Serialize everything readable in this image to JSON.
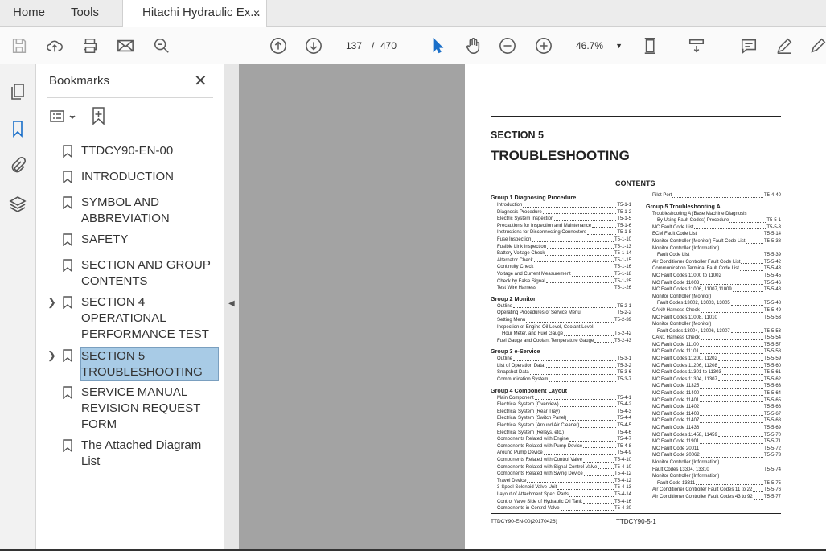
{
  "tabs": {
    "home": "Home",
    "tools": "Tools",
    "doc": "Hitachi Hydraulic Ex...",
    "close": "×"
  },
  "toolbar": {
    "page_current": "137",
    "page_sep": "/",
    "page_total": "470",
    "zoom": "46.7%"
  },
  "bookmarks": {
    "title": "Bookmarks",
    "close": "✕",
    "items": [
      {
        "label": "TTDCY90-EN-00",
        "expandable": false
      },
      {
        "label": "INTRODUCTION",
        "expandable": false
      },
      {
        "label": "SYMBOL AND ABBREVIATION",
        "expandable": false
      },
      {
        "label": "SAFETY",
        "expandable": false
      },
      {
        "label": "SECTION AND GROUP CONTENTS",
        "expandable": false
      },
      {
        "label": "SECTION 4 OPERATIONAL PERFORMANCE TEST",
        "expandable": true
      },
      {
        "label": "SECTION 5 TROUBLESHOOTING",
        "expandable": true,
        "selected": true
      },
      {
        "label": "SERVICE MANUAL REVISION REQUEST FORM",
        "expandable": false
      },
      {
        "label": "The Attached Diagram List",
        "expandable": false
      }
    ]
  },
  "page": {
    "section": "SECTION 5",
    "title": "TROUBLESHOOTING",
    "contents": "CONTENTS",
    "footer_left": "TTDCY90-EN-00(20170426)",
    "footer_right": "TTDCY90-5-1",
    "left_column": [
      {
        "h": "Group 1 Diagnosing Procedure"
      },
      {
        "t": "Introduction",
        "p": "T5-1-1"
      },
      {
        "t": "Diagnosis Procedure",
        "p": "T5-1-2"
      },
      {
        "t": "Electric System Inspection",
        "p": "T5-1-5"
      },
      {
        "t": "Precautions for Inspection and Maintenance",
        "p": "T5-1-6"
      },
      {
        "t": "Instructions for Disconnecting Connectors",
        "p": "T5-1-8"
      },
      {
        "t": "Fuse Inspection",
        "p": "T5-1-10"
      },
      {
        "t": "Fusible Link Inspection",
        "p": "T5-1-13"
      },
      {
        "t": "Battery Voltage Check",
        "p": "T5-1-14"
      },
      {
        "t": "Alternator Check",
        "p": "T5-1-15"
      },
      {
        "t": "Continuity Check",
        "p": "T5-1-16"
      },
      {
        "t": "Voltage and Current Measurement",
        "p": "T5-1-18"
      },
      {
        "t": "Check by False Signal",
        "p": "T5-1-25"
      },
      {
        "t": "Test Wire Harness",
        "p": "T5-1-26"
      },
      {
        "h": "Group 2 Monitor"
      },
      {
        "t": "Outline",
        "p": "T5-2-1"
      },
      {
        "t": "Operating Procedures of Service Menu",
        "p": "T5-2-2"
      },
      {
        "t": "Setting Menu",
        "p": "T5-2-39"
      },
      {
        "t": "Inspection of Engine Oil Level, Coolant Level,",
        "p": ""
      },
      {
        "t": "Hour Meter, and Fuel Gauge",
        "p": "T5-2-42",
        "i": 1
      },
      {
        "t": "Fuel Gauge and Coolant Temperature Gauge",
        "p": "T5-2-43"
      },
      {
        "h": "Group 3 e-Service"
      },
      {
        "t": "Outline",
        "p": "T5-3-1"
      },
      {
        "t": "List of Operation Data",
        "p": "T5-3-2"
      },
      {
        "t": "Snapshot Data",
        "p": "T5-3-6"
      },
      {
        "t": "Communication System",
        "p": "T5-3-7"
      },
      {
        "h": "Group 4 Component Layout"
      },
      {
        "t": "Main Component",
        "p": "T5-4-1"
      },
      {
        "t": "Electrical System (Overview)",
        "p": "T5-4-2"
      },
      {
        "t": "Electrical System (Rear Tray)",
        "p": "T5-4-3"
      },
      {
        "t": "Electrical System (Switch Panel)",
        "p": "T5-4-4"
      },
      {
        "t": "Electrical System (Around Air Cleaner)",
        "p": "T5-4-5"
      },
      {
        "t": "Electrical System (Relays, etc.)",
        "p": "T5-4-6"
      },
      {
        "t": "Components Related with Engine",
        "p": "T5-4-7"
      },
      {
        "t": "Components Related with Pump Device",
        "p": "T5-4-8"
      },
      {
        "t": "Around Pump Device",
        "p": "T5-4-9"
      },
      {
        "t": "Components Related with Control Valve",
        "p": "T5-4-10"
      },
      {
        "t": "Components Related with Signal Control Valve",
        "p": "T5-4-10"
      },
      {
        "t": "Components Related with Swing Device",
        "p": "T5-4-12"
      },
      {
        "t": "Travel Device",
        "p": "T5-4-12"
      },
      {
        "t": "3-Spool Solenoid Valve Unit",
        "p": "T5-4-13"
      },
      {
        "t": "Layout of Attachment Spec. Parts",
        "p": "T5-4-14"
      },
      {
        "t": "Control Valve Side of Hydraulic Oil Tank",
        "p": "T5-4-16"
      },
      {
        "t": "Components in Control Valve",
        "p": "T5-4-20"
      }
    ],
    "right_column": [
      {
        "t": "Pilot Port",
        "p": "T5-4-40"
      },
      {
        "h": "Group 5 Troubleshooting A"
      },
      {
        "t": "Troubleshooting A (Base Machine Diagnosis",
        "p": ""
      },
      {
        "t": "By Using Fault Codes) Procedure",
        "p": "T5-5-1",
        "i": 1
      },
      {
        "t": "MC Fault Code List",
        "p": "T5-5-3"
      },
      {
        "t": "ECM Fault Code List",
        "p": "T5-5-14"
      },
      {
        "t": "Monitor Controller (Monitor) Fault Code List",
        "p": "T5-5-38"
      },
      {
        "t": "Monitor Controller (Information)",
        "p": ""
      },
      {
        "t": "Fault Code List",
        "p": "T5-5-39",
        "i": 1
      },
      {
        "t": "Air Conditioner Controller Fault Code List",
        "p": "T5-5-42"
      },
      {
        "t": "Communication Terminal Fault Code List",
        "p": "T5-5-43"
      },
      {
        "t": "MC Fault Codes 11000 to 11002",
        "p": "T5-5-45"
      },
      {
        "t": "MC Fault Code 11003",
        "p": "T5-5-46"
      },
      {
        "t": "MC Fault Codes 11006, 11007,11009",
        "p": "T5-5-48"
      },
      {
        "t": "Monitor Controller (Monitor)",
        "p": ""
      },
      {
        "t": "Fault Codes 13002, 13003, 13005",
        "p": "T5-5-48",
        "i": 1
      },
      {
        "t": "CAN0 Harness Check",
        "p": "T5-5-49"
      },
      {
        "t": "MC Fault Codes 11008, 11010",
        "p": "T5-5-53"
      },
      {
        "t": "Monitor Controller (Monitor)",
        "p": ""
      },
      {
        "t": "Fault Codes 13004, 13006, 13007",
        "p": "T5-5-53",
        "i": 1
      },
      {
        "t": "CAN1 Harness Check",
        "p": "T5-5-54"
      },
      {
        "t": "MC Fault Code 11100",
        "p": "T5-5-57"
      },
      {
        "t": "MC Fault Code 11101",
        "p": "T5-5-58"
      },
      {
        "t": "MC Fault Codes 11200, 11202",
        "p": "T5-5-59"
      },
      {
        "t": "MC Fault Codes 11206, 11208",
        "p": "T5-5-60"
      },
      {
        "t": "MC Fault Codes 11301 to 11303",
        "p": "T5-5-61"
      },
      {
        "t": "MC Fault Codes 11304, 11307",
        "p": "T5-5-62"
      },
      {
        "t": "MC Fault Code 11325",
        "p": "T5-5-63"
      },
      {
        "t": "MC Fault Code 11400",
        "p": "T5-5-64"
      },
      {
        "t": "MC Fault Code 11401",
        "p": "T5-5-65"
      },
      {
        "t": "MC Fault Code 11402",
        "p": "T5-5-66"
      },
      {
        "t": "MC Fault Code 11403",
        "p": "T5-5-67"
      },
      {
        "t": "MC Fault Code 11407",
        "p": "T5-5-68"
      },
      {
        "t": "MC Fault Code 11436",
        "p": "T5-5-69"
      },
      {
        "t": "MC Fault Codes 11458, 11459",
        "p": "T5-5-70"
      },
      {
        "t": "MC Fault Code 11901",
        "p": "T5-5-71"
      },
      {
        "t": "MC Fault Code 20011",
        "p": "T5-5-72"
      },
      {
        "t": "MC Fault Code 20062",
        "p": "T5-5-73"
      },
      {
        "t": "Monitor Controller (Information)",
        "p": ""
      },
      {
        "t": "Fault Codes 13304, 13310",
        "p": "T5-5-74"
      },
      {
        "t": "Monitor Controller (Information)",
        "p": ""
      },
      {
        "t": "Fault Code 13311",
        "p": "T5-5-75",
        "i": 1
      },
      {
        "t": "Air Conditioner Controller Fault Codes 11 to 22",
        "p": "T5-5-76"
      },
      {
        "t": "Air Conditioner Controller Fault Codes 43 to 92",
        "p": "T5-5-77"
      }
    ]
  }
}
